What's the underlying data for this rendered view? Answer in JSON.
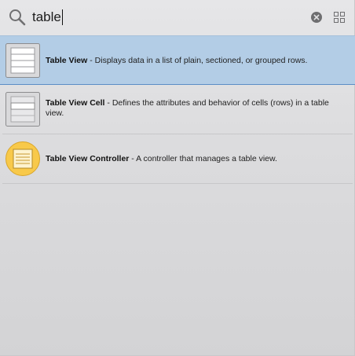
{
  "search": {
    "query": "table"
  },
  "results": [
    {
      "title": "Table View",
      "separator": " - ",
      "description": "Displays data in a list of plain, sectioned, or grouped rows.",
      "icon": "table-view-icon",
      "selected": true
    },
    {
      "title": "Table View Cell",
      "separator": " - ",
      "description": "Defines the attributes and behavior of cells (rows) in a table view.",
      "icon": "table-view-cell-icon",
      "selected": false
    },
    {
      "title": "Table View Controller",
      "separator": " - ",
      "description": "A controller that manages a table view.",
      "icon": "table-view-controller-icon",
      "selected": false
    }
  ],
  "colors": {
    "selection": "#b3cde6",
    "selection_border": "#5b8dc6",
    "controller_icon": "#f8c94a"
  }
}
